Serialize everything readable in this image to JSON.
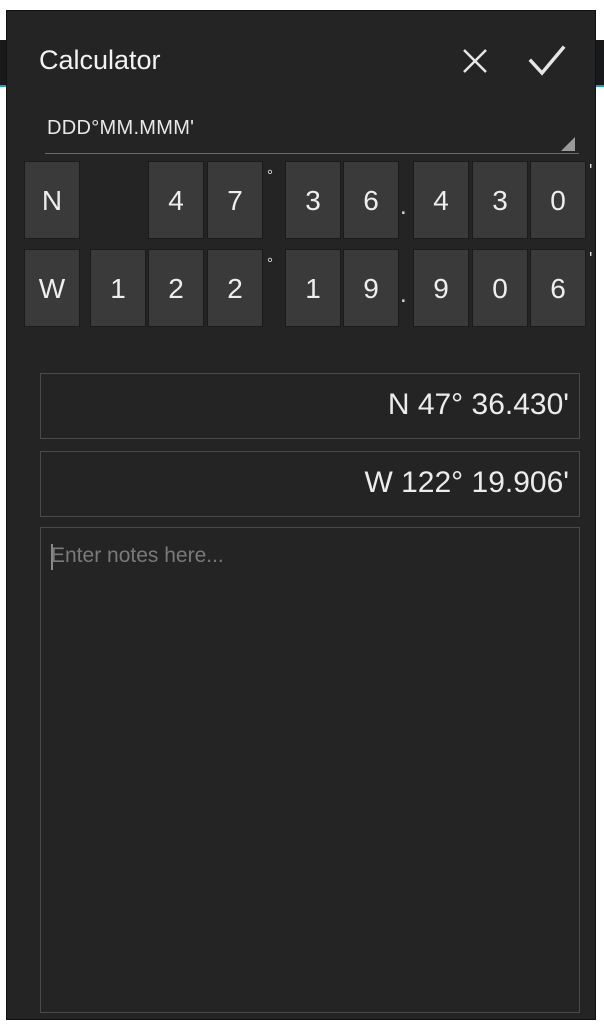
{
  "dialog": {
    "title": "Calculator",
    "cancel_icon": "close-icon",
    "confirm_icon": "check-icon"
  },
  "format_select": {
    "selected": "DDD°MM.MMM'"
  },
  "keypad": {
    "row1": {
      "hemisphere": "N",
      "deg_digits": [
        "",
        "4",
        "7"
      ],
      "min_digits": [
        "3",
        "6"
      ],
      "dec_digits": [
        "4",
        "3",
        "0"
      ]
    },
    "row2": {
      "hemisphere": "W",
      "deg_digits": [
        "1",
        "2",
        "2"
      ],
      "min_digits": [
        "1",
        "9"
      ],
      "dec_digits": [
        "9",
        "0",
        "6"
      ]
    },
    "degree_symbol": "°",
    "decimal_symbol": ".",
    "minute_symbol": "'"
  },
  "result": {
    "latitude": "N 47° 36.430'",
    "longitude": "W 122° 19.906'"
  },
  "notes": {
    "placeholder": "Enter notes here..."
  },
  "colors": {
    "dialog_bg": "#242424",
    "key_bg": "#3a3a3a",
    "accent": "#1f9fb8"
  }
}
